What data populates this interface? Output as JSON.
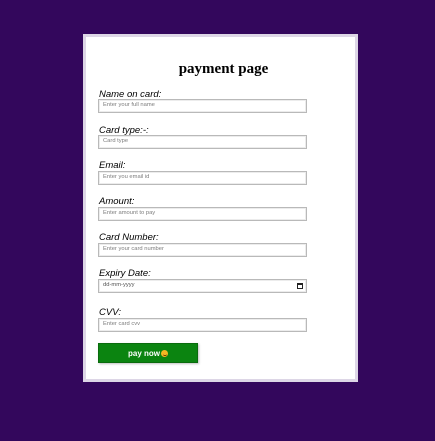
{
  "form": {
    "title": "payment page",
    "fields": [
      {
        "label": "Name on card:",
        "placeholder": "Enter your full name"
      },
      {
        "label": "Card type:-:",
        "placeholder": "Card type"
      },
      {
        "label": "Email:",
        "placeholder": "Enter you email id"
      },
      {
        "label": "Amount:",
        "placeholder": "Enter amount to pay"
      },
      {
        "label": "Card Number:",
        "placeholder": "Enter your card number"
      },
      {
        "label": "Expiry Date:",
        "placeholder": "dd-mm-yyyy",
        "icon": "calendar-icon"
      },
      {
        "label": "CVV:",
        "placeholder": "Enter card cvv"
      }
    ],
    "submit_label": "pay now",
    "submit_icon": "smile-emoji-icon"
  },
  "colors": {
    "background": "#33075c",
    "card": "#ffffff",
    "button": "#0b8410"
  }
}
